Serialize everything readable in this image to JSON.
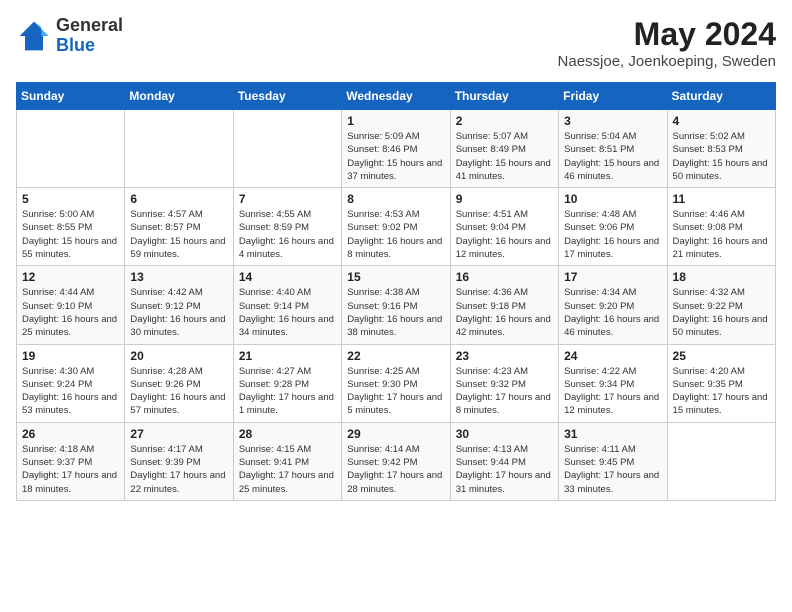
{
  "logo": {
    "general": "General",
    "blue": "Blue"
  },
  "header": {
    "month_year": "May 2024",
    "location": "Naessjoe, Joenkoeping, Sweden"
  },
  "weekdays": [
    "Sunday",
    "Monday",
    "Tuesday",
    "Wednesday",
    "Thursday",
    "Friday",
    "Saturday"
  ],
  "weeks": [
    [
      {
        "day": "",
        "text": ""
      },
      {
        "day": "",
        "text": ""
      },
      {
        "day": "",
        "text": ""
      },
      {
        "day": "1",
        "text": "Sunrise: 5:09 AM\nSunset: 8:46 PM\nDaylight: 15 hours and 37 minutes."
      },
      {
        "day": "2",
        "text": "Sunrise: 5:07 AM\nSunset: 8:49 PM\nDaylight: 15 hours and 41 minutes."
      },
      {
        "day": "3",
        "text": "Sunrise: 5:04 AM\nSunset: 8:51 PM\nDaylight: 15 hours and 46 minutes."
      },
      {
        "day": "4",
        "text": "Sunrise: 5:02 AM\nSunset: 8:53 PM\nDaylight: 15 hours and 50 minutes."
      }
    ],
    [
      {
        "day": "5",
        "text": "Sunrise: 5:00 AM\nSunset: 8:55 PM\nDaylight: 15 hours and 55 minutes."
      },
      {
        "day": "6",
        "text": "Sunrise: 4:57 AM\nSunset: 8:57 PM\nDaylight: 15 hours and 59 minutes."
      },
      {
        "day": "7",
        "text": "Sunrise: 4:55 AM\nSunset: 8:59 PM\nDaylight: 16 hours and 4 minutes."
      },
      {
        "day": "8",
        "text": "Sunrise: 4:53 AM\nSunset: 9:02 PM\nDaylight: 16 hours and 8 minutes."
      },
      {
        "day": "9",
        "text": "Sunrise: 4:51 AM\nSunset: 9:04 PM\nDaylight: 16 hours and 12 minutes."
      },
      {
        "day": "10",
        "text": "Sunrise: 4:48 AM\nSunset: 9:06 PM\nDaylight: 16 hours and 17 minutes."
      },
      {
        "day": "11",
        "text": "Sunrise: 4:46 AM\nSunset: 9:08 PM\nDaylight: 16 hours and 21 minutes."
      }
    ],
    [
      {
        "day": "12",
        "text": "Sunrise: 4:44 AM\nSunset: 9:10 PM\nDaylight: 16 hours and 25 minutes."
      },
      {
        "day": "13",
        "text": "Sunrise: 4:42 AM\nSunset: 9:12 PM\nDaylight: 16 hours and 30 minutes."
      },
      {
        "day": "14",
        "text": "Sunrise: 4:40 AM\nSunset: 9:14 PM\nDaylight: 16 hours and 34 minutes."
      },
      {
        "day": "15",
        "text": "Sunrise: 4:38 AM\nSunset: 9:16 PM\nDaylight: 16 hours and 38 minutes."
      },
      {
        "day": "16",
        "text": "Sunrise: 4:36 AM\nSunset: 9:18 PM\nDaylight: 16 hours and 42 minutes."
      },
      {
        "day": "17",
        "text": "Sunrise: 4:34 AM\nSunset: 9:20 PM\nDaylight: 16 hours and 46 minutes."
      },
      {
        "day": "18",
        "text": "Sunrise: 4:32 AM\nSunset: 9:22 PM\nDaylight: 16 hours and 50 minutes."
      }
    ],
    [
      {
        "day": "19",
        "text": "Sunrise: 4:30 AM\nSunset: 9:24 PM\nDaylight: 16 hours and 53 minutes."
      },
      {
        "day": "20",
        "text": "Sunrise: 4:28 AM\nSunset: 9:26 PM\nDaylight: 16 hours and 57 minutes."
      },
      {
        "day": "21",
        "text": "Sunrise: 4:27 AM\nSunset: 9:28 PM\nDaylight: 17 hours and 1 minute."
      },
      {
        "day": "22",
        "text": "Sunrise: 4:25 AM\nSunset: 9:30 PM\nDaylight: 17 hours and 5 minutes."
      },
      {
        "day": "23",
        "text": "Sunrise: 4:23 AM\nSunset: 9:32 PM\nDaylight: 17 hours and 8 minutes."
      },
      {
        "day": "24",
        "text": "Sunrise: 4:22 AM\nSunset: 9:34 PM\nDaylight: 17 hours and 12 minutes."
      },
      {
        "day": "25",
        "text": "Sunrise: 4:20 AM\nSunset: 9:35 PM\nDaylight: 17 hours and 15 minutes."
      }
    ],
    [
      {
        "day": "26",
        "text": "Sunrise: 4:18 AM\nSunset: 9:37 PM\nDaylight: 17 hours and 18 minutes."
      },
      {
        "day": "27",
        "text": "Sunrise: 4:17 AM\nSunset: 9:39 PM\nDaylight: 17 hours and 22 minutes."
      },
      {
        "day": "28",
        "text": "Sunrise: 4:15 AM\nSunset: 9:41 PM\nDaylight: 17 hours and 25 minutes."
      },
      {
        "day": "29",
        "text": "Sunrise: 4:14 AM\nSunset: 9:42 PM\nDaylight: 17 hours and 28 minutes."
      },
      {
        "day": "30",
        "text": "Sunrise: 4:13 AM\nSunset: 9:44 PM\nDaylight: 17 hours and 31 minutes."
      },
      {
        "day": "31",
        "text": "Sunrise: 4:11 AM\nSunset: 9:45 PM\nDaylight: 17 hours and 33 minutes."
      },
      {
        "day": "",
        "text": ""
      }
    ]
  ]
}
